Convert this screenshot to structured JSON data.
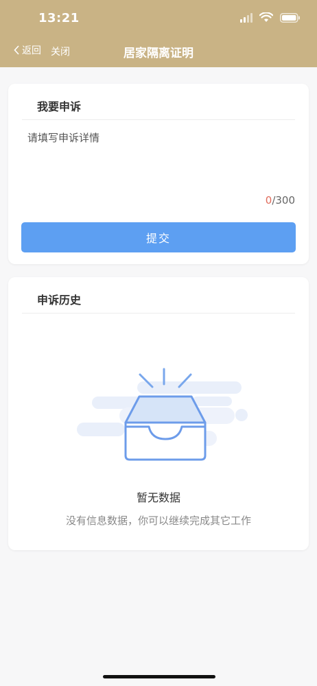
{
  "status": {
    "time": "13:21"
  },
  "nav": {
    "back_label": "返回",
    "close_label": "关闭",
    "title": "居家隔离证明"
  },
  "appeal": {
    "title": "我要申诉",
    "placeholder": "请填写申诉详情",
    "count_current": "0",
    "count_max": "/300",
    "submit_label": "提交"
  },
  "history": {
    "title": "申诉历史",
    "empty_title": "暂无数据",
    "empty_desc": "没有信息数据，你可以继续完成其它工作"
  },
  "colors": {
    "header": "#c9b385",
    "button": "#5d9ff2",
    "counter_current": "#e06b5b"
  }
}
